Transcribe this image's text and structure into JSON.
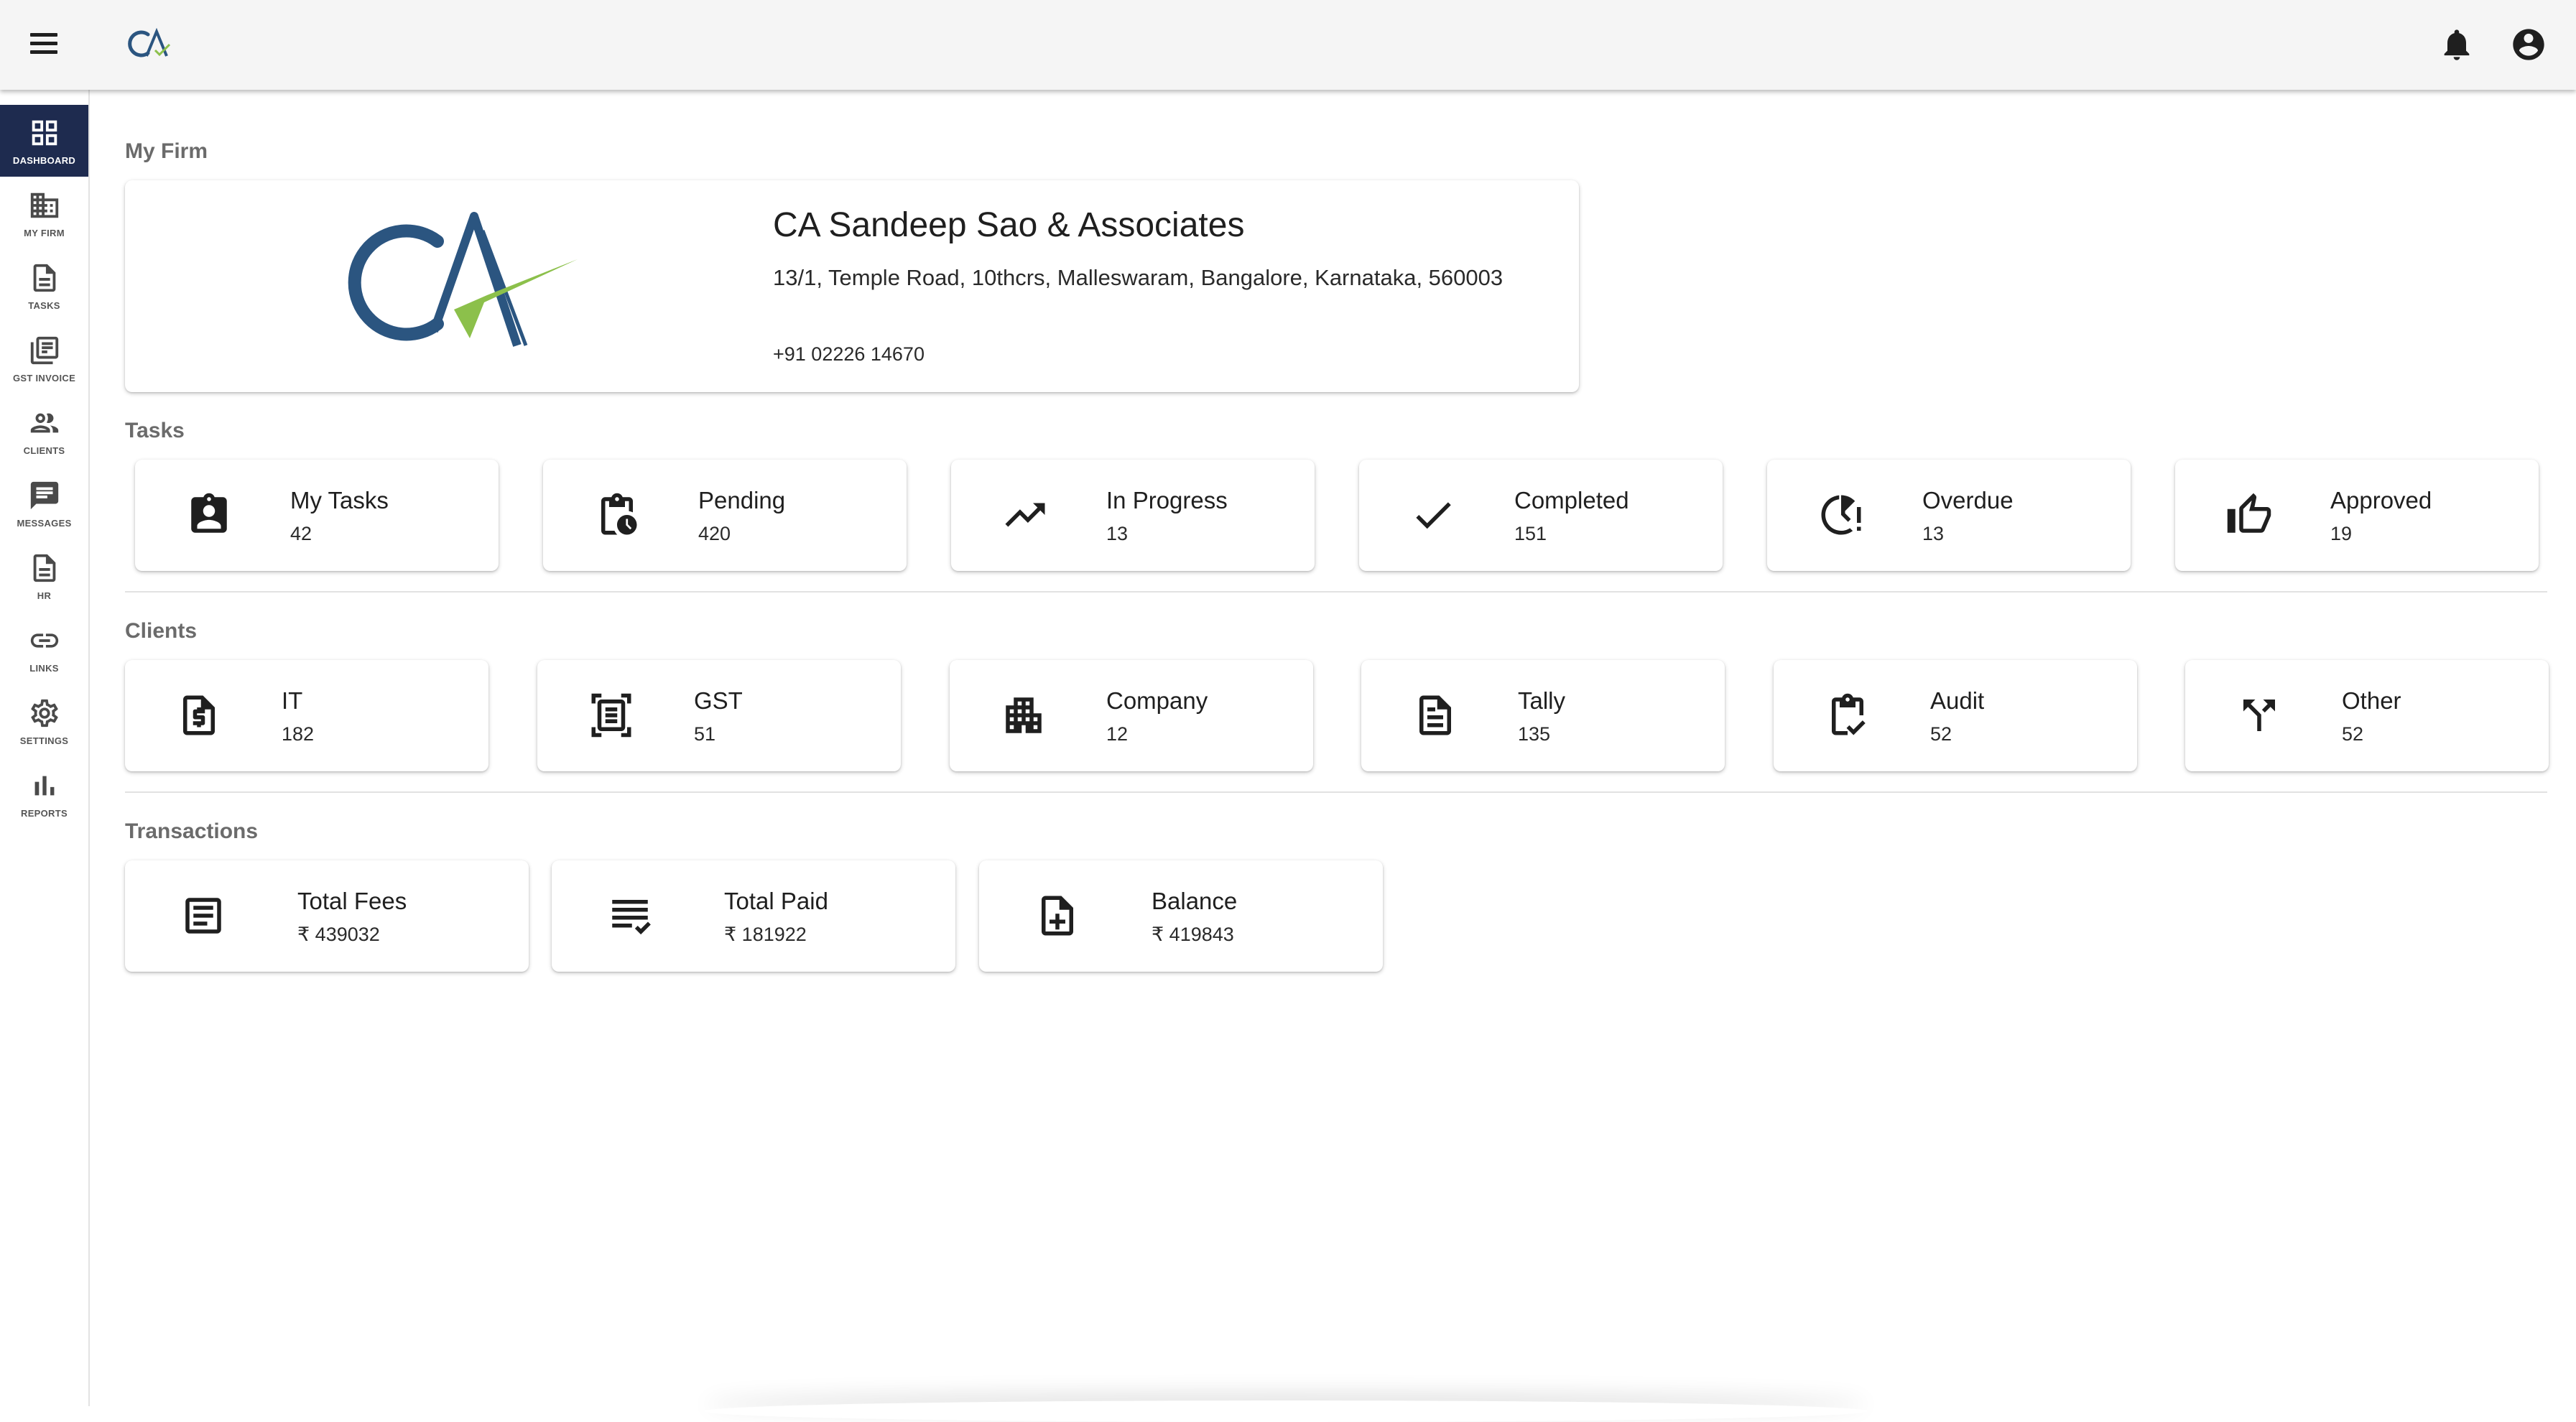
{
  "topbar": {
    "menu_icon": "menu-icon",
    "logo_text": "CA",
    "notifications_icon": "bell-icon",
    "account_icon": "account-circle-icon"
  },
  "sidebar": {
    "items": [
      {
        "label": "DASHBOARD",
        "icon": "dashboard-icon",
        "active": true
      },
      {
        "label": "MY FIRM",
        "icon": "building-icon"
      },
      {
        "label": "TASKS",
        "icon": "document-icon"
      },
      {
        "label": "GST INVOICE",
        "icon": "library-books-icon"
      },
      {
        "label": "CLIENTS",
        "icon": "people-icon"
      },
      {
        "label": "MESSAGES",
        "icon": "chat-icon"
      },
      {
        "label": "HR",
        "icon": "document-icon"
      },
      {
        "label": "LINKS",
        "icon": "link-icon"
      },
      {
        "label": "SETTINGS",
        "icon": "gear-icon"
      },
      {
        "label": "REPORTS",
        "icon": "bar-chart-icon"
      }
    ],
    "active_color": "#1e2b4f"
  },
  "firm": {
    "section_title": "My Firm",
    "logo_text": "CA",
    "name": "CA Sandeep Sao & Associates",
    "address": "13/1, Temple Road, 10thcrs, Malleswaram, Bangalore, Karnataka, 560003",
    "phone": "+91 02226 14670",
    "brand_blue": "#2b5580",
    "brand_green": "#8cc04b"
  },
  "tasks": {
    "section_title": "Tasks",
    "cards": [
      {
        "label": "My Tasks",
        "value": "42",
        "icon": "assignment-ind-icon"
      },
      {
        "label": "Pending",
        "value": "420",
        "icon": "pending-actions-icon"
      },
      {
        "label": "In Progress",
        "value": "13",
        "icon": "trending-up-icon"
      },
      {
        "label": "Completed",
        "value": "151",
        "icon": "check-icon"
      },
      {
        "label": "Overdue",
        "value": "13",
        "icon": "overdue-clock-icon"
      },
      {
        "label": "Approved",
        "value": "19",
        "icon": "thumb-up-icon"
      }
    ]
  },
  "clients": {
    "section_title": "Clients",
    "cards": [
      {
        "label": "IT",
        "value": "182",
        "icon": "request-quote-icon"
      },
      {
        "label": "GST",
        "value": "51",
        "icon": "document-scanner-icon"
      },
      {
        "label": "Company",
        "value": "12",
        "icon": "apartment-icon"
      },
      {
        "label": "Tally",
        "value": "135",
        "icon": "article-icon"
      },
      {
        "label": "Audit",
        "value": "52",
        "icon": "assignment-turned-in-icon"
      },
      {
        "label": "Other",
        "value": "52",
        "icon": "call-split-icon"
      }
    ]
  },
  "transactions": {
    "section_title": "Transactions",
    "cards": [
      {
        "label": "Total Fees",
        "value": "₹ 439032",
        "icon": "receipt-icon"
      },
      {
        "label": "Total Paid",
        "value": "₹ 181922",
        "icon": "checklist-icon"
      },
      {
        "label": "Balance",
        "value": "₹ 419843",
        "icon": "note-add-icon"
      }
    ]
  }
}
